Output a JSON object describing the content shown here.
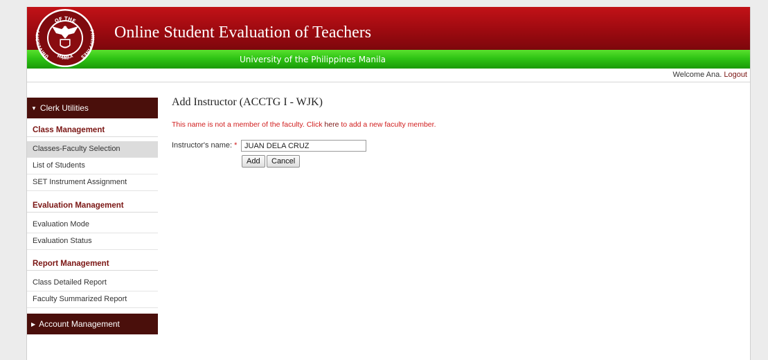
{
  "header": {
    "title": "Online Student Evaluation of Teachers",
    "subtitle": "University of the Philippines Manila",
    "logo_text_top": "OF THE",
    "logo_text_left": "UNIVERSITY",
    "logo_text_right": "PHILIPPINES",
    "logo_text_bottom": "MANILA",
    "logo_year": "1908"
  },
  "userbar": {
    "welcome": "Welcome Ana.",
    "logout": "Logout"
  },
  "sidebar": {
    "clerk_utilities": "Clerk Utilities",
    "class_management": {
      "title": "Class Management",
      "items": [
        "Classes-Faculty Selection",
        "List of Students",
        "SET Instrument Assignment"
      ]
    },
    "evaluation_management": {
      "title": "Evaluation Management",
      "items": [
        "Evaluation Mode",
        "Evaluation Status"
      ]
    },
    "report_management": {
      "title": "Report Management",
      "items": [
        "Class Detailed Report",
        "Faculty Summarized Report"
      ]
    },
    "account_management": "Account Management"
  },
  "main": {
    "heading": "Add Instructor (ACCTG I - WJK)",
    "notice_prefix": "This name is not a member of the faculty. Click ",
    "notice_link": "here",
    "notice_suffix": " to add a new faculty member.",
    "field_label": "Instructor's name:",
    "required_mark": "*",
    "instructor_name": "JUAN DELA CRUZ",
    "add_label": "Add",
    "cancel_label": "Cancel"
  },
  "colors": {
    "banner_red": "#9d0a10",
    "banner_green": "#2fc415",
    "sidebar_header": "#4a0f0b",
    "accent": "#7a1513",
    "error": "#d01c1c"
  }
}
